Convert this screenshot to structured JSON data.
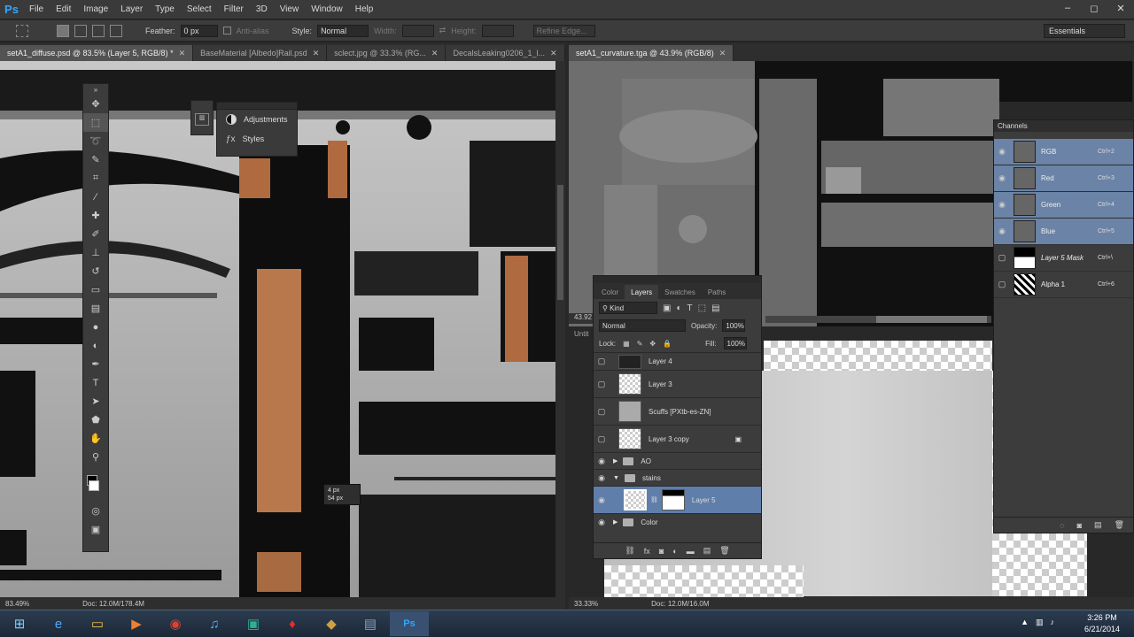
{
  "menubar": {
    "logo": "Ps",
    "items": [
      "File",
      "Edit",
      "Image",
      "Layer",
      "Type",
      "Select",
      "Filter",
      "3D",
      "View",
      "Window",
      "Help"
    ],
    "window_controls": [
      "–",
      "◻",
      "✕"
    ]
  },
  "options": {
    "feather_label": "Feather:",
    "feather_value": "0 px",
    "antialias_label": "Anti-alias",
    "style_label": "Style:",
    "style_value": "Normal",
    "width_label": "Width:",
    "height_label": "Height:",
    "refine_label": "Refine Edge...",
    "workspace": "Essentials"
  },
  "left_tabs": [
    {
      "label": "setA1_diffuse.psd @ 83.5% (Layer 5, RGB/8) *",
      "active": true
    },
    {
      "label": "BaseMaterial [Albedo]Rail.psd",
      "active": false
    },
    {
      "label": "sclect.jpg @ 33.3% (RG...",
      "active": false
    },
    {
      "label": "DecalsLeaking0206_1_l...",
      "active": false
    }
  ],
  "right_tabs": [
    {
      "label": "setA1_curvature.tga @ 43.9% (RGB/8)",
      "active": true
    }
  ],
  "left_status": {
    "zoom": "83.49%",
    "doc": "Doc: 12.0M/178.4M"
  },
  "right_status": {
    "zoom": "33.33%",
    "doc": "Doc: 12.0M/16.0M"
  },
  "right_overlap_zoom": "43.92",
  "right_overlap_label": "Untit",
  "tooltip": {
    "line1": "4 px",
    "line2": "54 px"
  },
  "adjustments": {
    "items": [
      "Adjustments",
      "Styles"
    ]
  },
  "layers_panel": {
    "tabs": [
      "Color",
      "Layers",
      "Swatches",
      "Paths"
    ],
    "active_tab": "Layers",
    "kind": "Kind",
    "blend": "Normal",
    "opacity_label": "Opacity:",
    "opacity": "100%",
    "lock_label": "Lock:",
    "fill_label": "Fill:",
    "fill": "100%",
    "layers": [
      {
        "name": "Layer 4",
        "visible": false,
        "type": "layer"
      },
      {
        "name": "Layer 3",
        "visible": false,
        "type": "layer"
      },
      {
        "name": "Scuffs [PXtb-es-ZN]",
        "visible": false,
        "type": "layer"
      },
      {
        "name": "Layer 3 copy",
        "visible": false,
        "type": "layer"
      },
      {
        "name": "AO",
        "visible": true,
        "type": "group"
      },
      {
        "name": "stains",
        "visible": true,
        "type": "group-open"
      },
      {
        "name": "Layer 5",
        "visible": true,
        "type": "layer-mask",
        "selected": true
      },
      {
        "name": "Color",
        "visible": true,
        "type": "group"
      }
    ],
    "footer_icons": [
      "link-icon",
      "fx-icon",
      "mask-icon",
      "adjustment-icon",
      "folder-icon",
      "new-layer-icon",
      "trash-icon"
    ]
  },
  "channels_panel": {
    "title": "Channels",
    "channels": [
      {
        "name": "RGB",
        "shortcut": "Ctrl+2",
        "selected": true
      },
      {
        "name": "Red",
        "shortcut": "Ctrl+3",
        "selected": true
      },
      {
        "name": "Green",
        "shortcut": "Ctrl+4",
        "selected": true
      },
      {
        "name": "Blue",
        "shortcut": "Ctrl+5",
        "selected": true
      },
      {
        "name": "Layer 5 Mask",
        "shortcut": "Ctrl+\\",
        "selected": false
      },
      {
        "name": "Alpha 1",
        "shortcut": "Ctrl+6",
        "selected": false
      }
    ]
  },
  "taskbar": {
    "time": "3:26 PM",
    "date": "6/21/2014",
    "apps": [
      "start",
      "ie",
      "explorer",
      "media",
      "chrome",
      "itunes",
      "app",
      "flame",
      "app2",
      "app3",
      "photoshop"
    ]
  },
  "colors": {
    "selection": "#5f7eaa",
    "ps_blue": "#31a8ff"
  }
}
